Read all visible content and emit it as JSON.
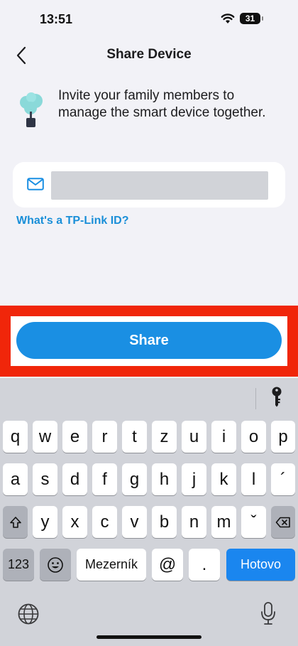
{
  "status": {
    "time": "13:51",
    "battery": "31"
  },
  "nav": {
    "title": "Share Device"
  },
  "invite": {
    "text": "Invite your family members to manage the smart device together."
  },
  "email": {
    "value": "",
    "placeholder": ""
  },
  "link": {
    "tplink_id": "What's a TP-Link ID?"
  },
  "share": {
    "label": "Share"
  },
  "keyboard": {
    "row1": [
      "q",
      "w",
      "e",
      "r",
      "t",
      "z",
      "u",
      "i",
      "o",
      "p"
    ],
    "row2": [
      "a",
      "s",
      "d",
      "f",
      "g",
      "h",
      "j",
      "k",
      "l",
      "´"
    ],
    "row3": [
      "y",
      "x",
      "c",
      "v",
      "b",
      "n",
      "m",
      "ˇ"
    ],
    "numbers": "123",
    "space": "Mezerník",
    "at": "@",
    "dot": ".",
    "done": "Hotovo"
  },
  "colors": {
    "accent": "#1a8fe3",
    "highlight": "#f0260a",
    "link": "#1a8fd8"
  }
}
